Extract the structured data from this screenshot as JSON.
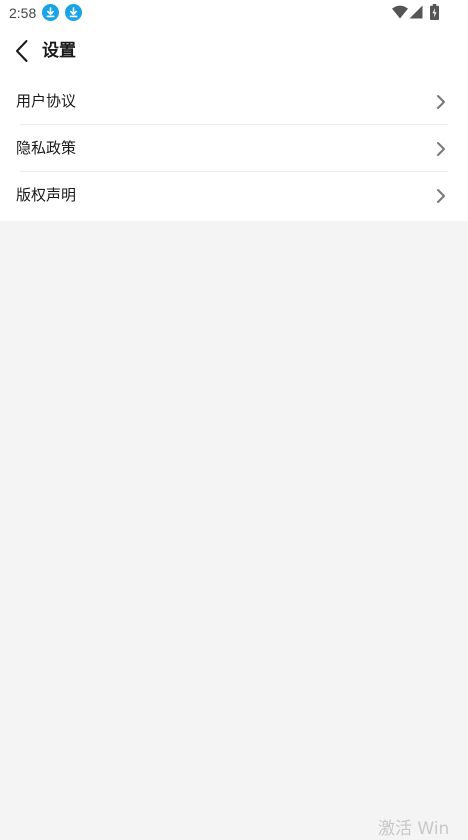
{
  "status_bar": {
    "time": "2:58",
    "notification_icons": [
      "download-icon",
      "download-icon"
    ],
    "system_icons": [
      "wifi-icon",
      "cellular-signal-icon",
      "battery-charging-icon"
    ],
    "notification_color": "#1aa4e8"
  },
  "header": {
    "title": "设置",
    "back_icon": "chevron-left-icon"
  },
  "menu": {
    "items": [
      {
        "label": "用户协议",
        "icon": "chevron-right-icon"
      },
      {
        "label": "隐私政策",
        "icon": "chevron-right-icon"
      },
      {
        "label": "版权声明",
        "icon": "chevron-right-icon"
      }
    ]
  },
  "watermark": {
    "text": "激活 Win"
  },
  "colors": {
    "background": "#f4f4f4",
    "surface": "#ffffff",
    "text": "#1a1a1a",
    "chevron": "#777777"
  }
}
